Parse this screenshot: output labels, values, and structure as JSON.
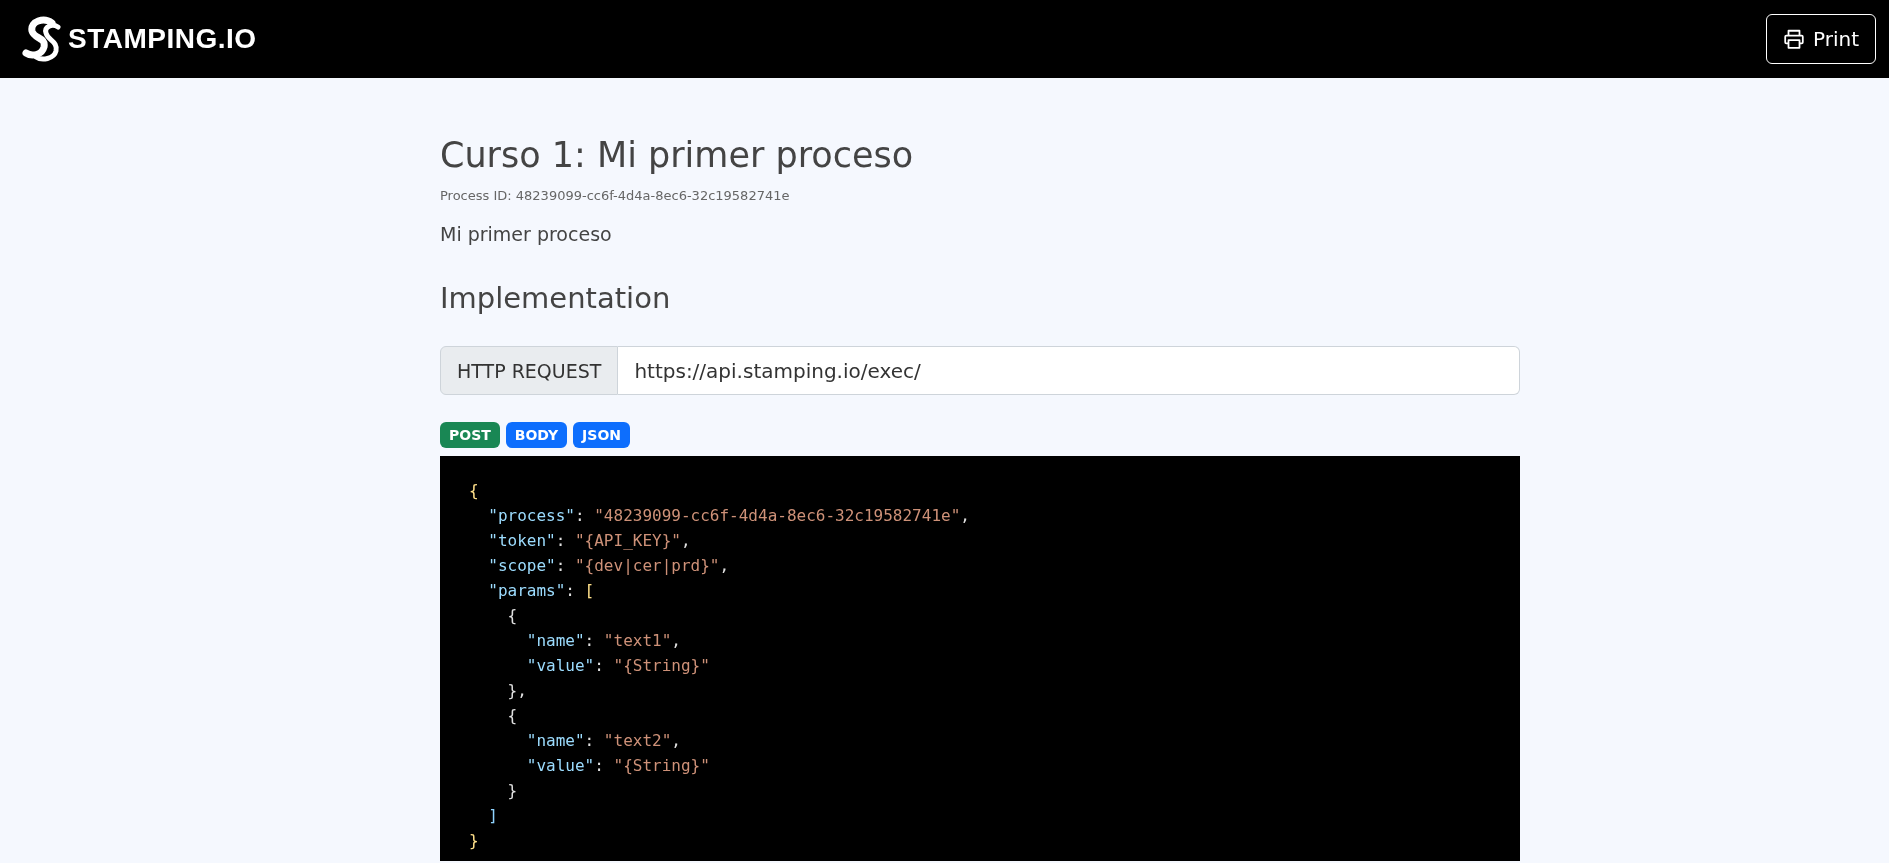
{
  "header": {
    "logo_text": "STAMPING.IO",
    "print_button": "Print"
  },
  "page": {
    "title": "Curso 1: Mi primer proceso",
    "process_id": "Process ID: 48239099-cc6f-4d4a-8ec6-32c19582741e",
    "description": "Mi primer proceso",
    "section_title": "Implementation"
  },
  "request": {
    "label": "HTTP REQUEST",
    "value": "https://api.stamping.io/exec/"
  },
  "badges": [
    {
      "label": "POST",
      "color": "#198754"
    },
    {
      "label": "BODY",
      "color": "#0d6efd"
    },
    {
      "label": "JSON",
      "color": "#0d6efd"
    }
  ],
  "code_lines": [
    [
      {
        "kind": "bracket",
        "text": "{"
      }
    ],
    [
      {
        "kind": "key",
        "text": "  \"process\""
      },
      {
        "kind": "punct",
        "text": ": "
      },
      {
        "kind": "string",
        "text": "\"48239099-cc6f-4d4a-8ec6-32c19582741e\""
      },
      {
        "kind": "punct",
        "text": ","
      }
    ],
    [
      {
        "kind": "key",
        "text": "  \"token\""
      },
      {
        "kind": "punct",
        "text": ": "
      },
      {
        "kind": "string",
        "text": "\"{API_KEY}\""
      },
      {
        "kind": "punct",
        "text": ","
      }
    ],
    [
      {
        "kind": "key",
        "text": "  \"scope\""
      },
      {
        "kind": "punct",
        "text": ": "
      },
      {
        "kind": "string",
        "text": "\"{dev|cer|prd}\""
      },
      {
        "kind": "punct",
        "text": ","
      }
    ],
    [
      {
        "kind": "key",
        "text": "  \"params\""
      },
      {
        "kind": "punct",
        "text": ": "
      },
      {
        "kind": "bracket",
        "text": "["
      }
    ],
    [
      {
        "kind": "punct",
        "text": "    {"
      }
    ],
    [
      {
        "kind": "key",
        "text": "      \"name\""
      },
      {
        "kind": "punct",
        "text": ": "
      },
      {
        "kind": "string",
        "text": "\"text1\""
      },
      {
        "kind": "punct",
        "text": ","
      }
    ],
    [
      {
        "kind": "key",
        "text": "      \"value\""
      },
      {
        "kind": "punct",
        "text": ": "
      },
      {
        "kind": "string",
        "text": "\"{String}\""
      }
    ],
    [
      {
        "kind": "punct",
        "text": "    },"
      }
    ],
    [
      {
        "kind": "punct",
        "text": "    {"
      }
    ],
    [
      {
        "kind": "key",
        "text": "      \"name\""
      },
      {
        "kind": "punct",
        "text": ": "
      },
      {
        "kind": "string",
        "text": "\"text2\""
      },
      {
        "kind": "punct",
        "text": ","
      }
    ],
    [
      {
        "kind": "key",
        "text": "      \"value\""
      },
      {
        "kind": "punct",
        "text": ": "
      },
      {
        "kind": "string",
        "text": "\"{String}\""
      }
    ],
    [
      {
        "kind": "punct",
        "text": "    }"
      }
    ],
    [
      {
        "kind": "bracket2",
        "text": "  ]"
      }
    ],
    [
      {
        "kind": "bracket",
        "text": "}"
      }
    ]
  ]
}
